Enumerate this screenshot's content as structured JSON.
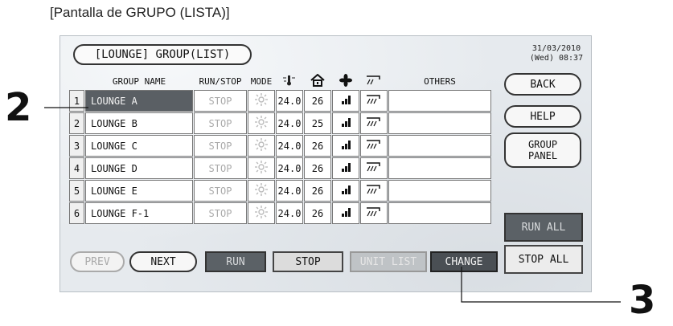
{
  "caption": "[Pantalla de GRUPO (LISTA)]",
  "title": "[LOUNGE] GROUP(LIST)",
  "datetime": {
    "date": "31/03/2010",
    "time": "(Wed) 08:37"
  },
  "columns": {
    "group_name": "GROUP NAME",
    "run_stop": "RUN/STOP",
    "mode": "MODE",
    "others": "OTHERS"
  },
  "icons": {
    "set_temp": "thermometer-icon",
    "room_temp": "house-icon",
    "fan": "fan-icon",
    "vane": "air-direction-icon",
    "mode": "sun-icon"
  },
  "rows": [
    {
      "num": "1",
      "name": "LOUNGE A",
      "status": "STOP",
      "set": "24.0",
      "room": "26"
    },
    {
      "num": "2",
      "name": "LOUNGE B",
      "status": "STOP",
      "set": "24.0",
      "room": "25"
    },
    {
      "num": "3",
      "name": "LOUNGE C",
      "status": "STOP",
      "set": "24.0",
      "room": "26"
    },
    {
      "num": "4",
      "name": "LOUNGE D",
      "status": "STOP",
      "set": "24.0",
      "room": "26"
    },
    {
      "num": "5",
      "name": "LOUNGE E",
      "status": "STOP",
      "set": "24.0",
      "room": "26"
    },
    {
      "num": "6",
      "name": "LOUNGE F-1",
      "status": "STOP",
      "set": "24.0",
      "room": "26"
    }
  ],
  "buttons": {
    "back": "BACK",
    "help": "HELP",
    "group_panel_1": "GROUP",
    "group_panel_2": "PANEL",
    "run_all": "RUN ALL",
    "stop_all": "STOP ALL",
    "prev": "PREV",
    "next": "NEXT",
    "run": "RUN",
    "stop": "STOP",
    "unit_list": "UNIT LIST",
    "change": "CHANGE"
  },
  "callouts": {
    "left": "2",
    "right": "3"
  }
}
